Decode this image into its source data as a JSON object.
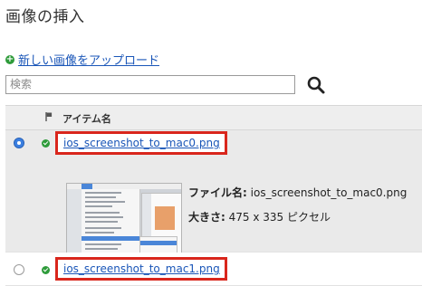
{
  "page": {
    "title": "画像の挿入"
  },
  "upload": {
    "link_label": "新しい画像をアップロード",
    "icon": "plus-circle-icon"
  },
  "search": {
    "placeholder": "検索",
    "value": "",
    "icon": "search-icon"
  },
  "table": {
    "header": {
      "flag_icon": "flag-icon",
      "item_name": "アイテム名"
    },
    "rows": [
      {
        "selected": true,
        "status_icon": "check-circle-icon",
        "filename": "ios_screenshot_to_mac0.png",
        "file_name_label": "ファイル名:",
        "file_name_value": "ios_screenshot_to_mac0.png",
        "size_label": "大きさ:",
        "size_value": "475 x 335 ピクセル"
      },
      {
        "selected": false,
        "status_icon": "check-circle-icon",
        "filename": "ios_screenshot_to_mac1.png"
      }
    ]
  },
  "colors": {
    "link": "#1a56b8",
    "highlight_border": "#d9261c",
    "status_green": "#2e9b3a",
    "radio_selected": "#3b7fe0"
  }
}
